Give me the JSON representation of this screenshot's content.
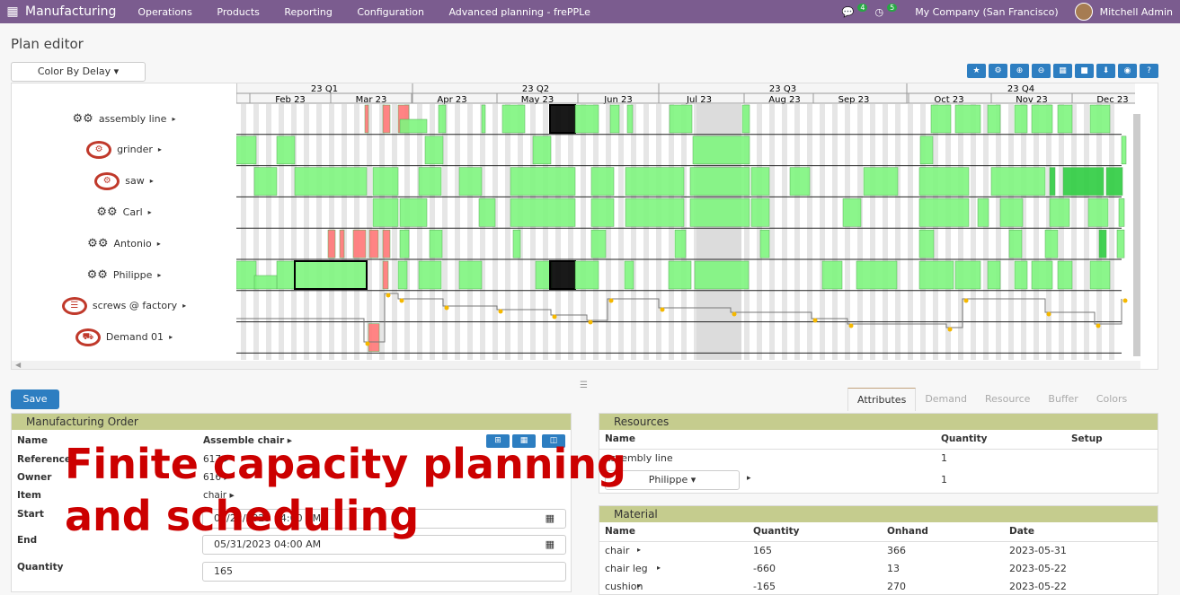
{
  "topbar": {
    "app": "Manufacturing",
    "menu": [
      "Operations",
      "Products",
      "Reporting",
      "Configuration",
      "Advanced planning - frePPLe"
    ],
    "chat_count": "4",
    "activity_count": "5",
    "company": "My Company (San Francisco)",
    "user": "Mitchell Admin"
  },
  "page_title": "Plan editor",
  "colorby": "Color By Delay",
  "gantt": {
    "quarters": [
      {
        "label": "23 Q1"
      },
      {
        "label": "23 Q2"
      },
      {
        "label": "23 Q3"
      },
      {
        "label": "23 Q4"
      }
    ],
    "months": [
      "Feb 23",
      "Mar 23",
      "Apr 23",
      "May 23",
      "Jun 23",
      "Jul 23",
      "Aug 23",
      "Sep 23",
      "Oct 23",
      "Nov 23",
      "Dec 23"
    ],
    "rows": [
      {
        "label": "assembly line",
        "icon": "gears-icon"
      },
      {
        "label": "grinder",
        "icon": "no-gears-icon"
      },
      {
        "label": "saw",
        "icon": "no-gears-icon"
      },
      {
        "label": "Carl",
        "icon": "gears-icon"
      },
      {
        "label": "Antonio",
        "icon": "gears-icon"
      },
      {
        "label": "Philippe",
        "icon": "gears-icon"
      },
      {
        "label": "screws @ factory",
        "icon": "no-buffer-icon"
      },
      {
        "label": "Demand 01",
        "icon": "no-truck-icon"
      }
    ]
  },
  "save": "Save",
  "tabs": [
    "Attributes",
    "Demand",
    "Resource",
    "Buffer",
    "Colors"
  ],
  "mo": {
    "header": "Manufacturing Order",
    "labels": {
      "name": "Name",
      "reference": "Reference",
      "owner": "Owner",
      "item": "Item",
      "start": "Start",
      "end": "End",
      "quantity": "Quantity"
    },
    "name": "Assemble chair",
    "reference": "617",
    "owner": "616",
    "item": "chair",
    "start": "05/22/2023 04:00 AM",
    "end": "05/31/2023 04:00 AM",
    "quantity": "165"
  },
  "resources": {
    "header": "Resources",
    "cols": [
      "Name",
      "Quantity",
      "Setup"
    ],
    "rows": [
      {
        "name": "assembly line",
        "qty": "1"
      },
      {
        "name": "Philippe",
        "qty": "1"
      }
    ]
  },
  "material": {
    "header": "Material",
    "cols": [
      "Name",
      "Quantity",
      "Onhand",
      "Date"
    ],
    "rows": [
      {
        "name": "chair",
        "qty": "165",
        "onhand": "366",
        "date": "2023-05-31"
      },
      {
        "name": "chair leg",
        "qty": "-660",
        "onhand": "13",
        "date": "2023-05-22"
      },
      {
        "name": "cushion",
        "qty": "-165",
        "onhand": "270",
        "date": "2023-05-22"
      }
    ]
  },
  "overlay": [
    "Finite capacity planning",
    "and scheduling"
  ]
}
